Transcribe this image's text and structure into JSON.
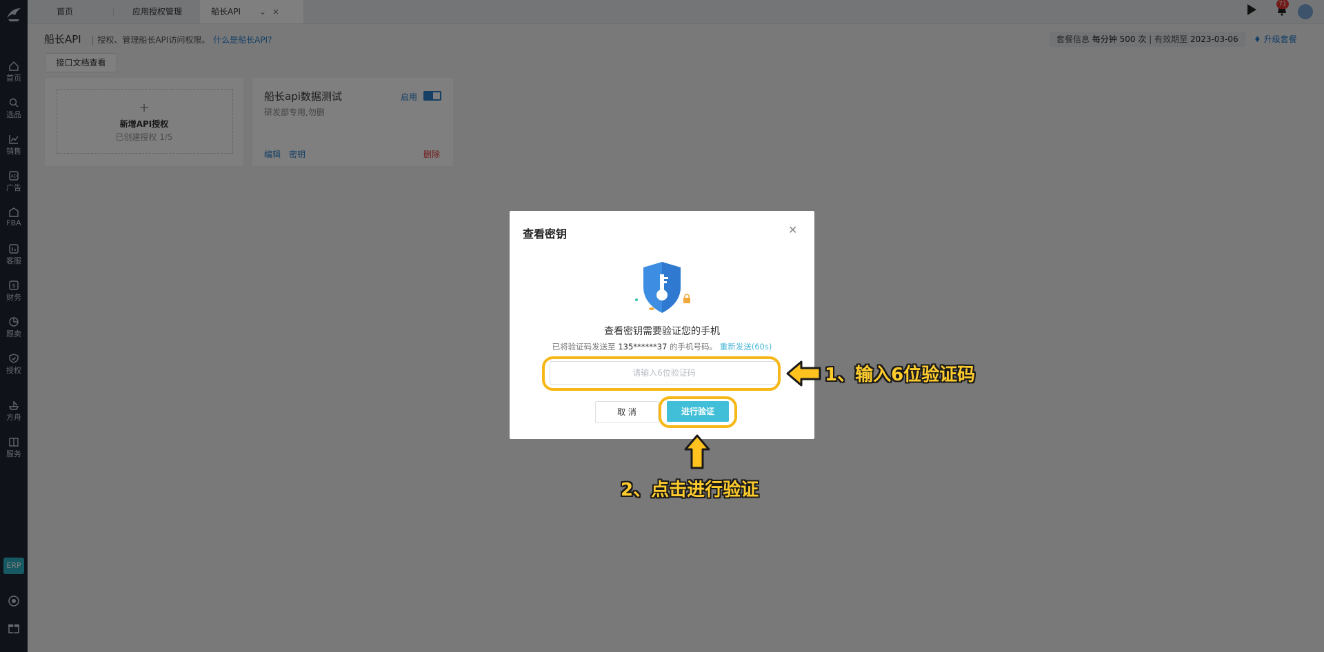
{
  "tabs": [
    {
      "label": "首页"
    },
    {
      "label": "应用授权管理"
    },
    {
      "label": "船长API"
    }
  ],
  "notifications_count": "71",
  "sidebar": {
    "items": [
      {
        "label": "首页",
        "icon": "home-icon"
      },
      {
        "label": "选品",
        "icon": "search-icon"
      },
      {
        "label": "销售",
        "icon": "chart-line-icon"
      },
      {
        "label": "广告",
        "icon": "ad-icon"
      },
      {
        "label": "FBA",
        "icon": "warehouse-icon"
      },
      {
        "label": "客服",
        "icon": "customer-service-icon"
      },
      {
        "label": "财务",
        "icon": "finance-icon"
      },
      {
        "label": "跟卖",
        "icon": "pie-chart-icon"
      },
      {
        "label": "授权",
        "icon": "shield-check-icon"
      },
      {
        "label": "方舟",
        "icon": "ark-icon"
      },
      {
        "label": "服务",
        "icon": "building-icon"
      }
    ],
    "erp_label": "ERP"
  },
  "header": {
    "title": "船长API",
    "subtitle": "授权、管理船长API访问权限。",
    "what_link": "什么是船长API?",
    "plan_label": "套餐信息",
    "plan_rate": "每分钟 500 次",
    "expire_label": "有效期至",
    "expire_date": "2023-03-06",
    "upgrade_label": "升级套餐"
  },
  "doc_button": "接口文档查看",
  "add_card": {
    "title": "新增API授权",
    "sub": "已创建授权 1/5"
  },
  "api_card": {
    "name": "船长api数据测试",
    "desc": "研发部专用,勿删",
    "status": "启用",
    "edit": "编辑",
    "key": "密钥",
    "delete": "删除"
  },
  "modal": {
    "title": "查看密钥",
    "heading": "查看密钥需要验证您的手机",
    "sent_prefix": "已将验证码发送至",
    "phone": "135******37",
    "sent_suffix": "的手机号码。",
    "resend": "重新发送(60s)",
    "placeholder": "请输入6位验证码",
    "cancel": "取 消",
    "verify": "进行验证"
  },
  "annotations": {
    "step1": "1、输入6位验证码",
    "step2": "2、点击进行验证"
  },
  "colors": {
    "accent": "#41bfd9",
    "highlight": "#f6b818",
    "danger": "#e53935"
  }
}
